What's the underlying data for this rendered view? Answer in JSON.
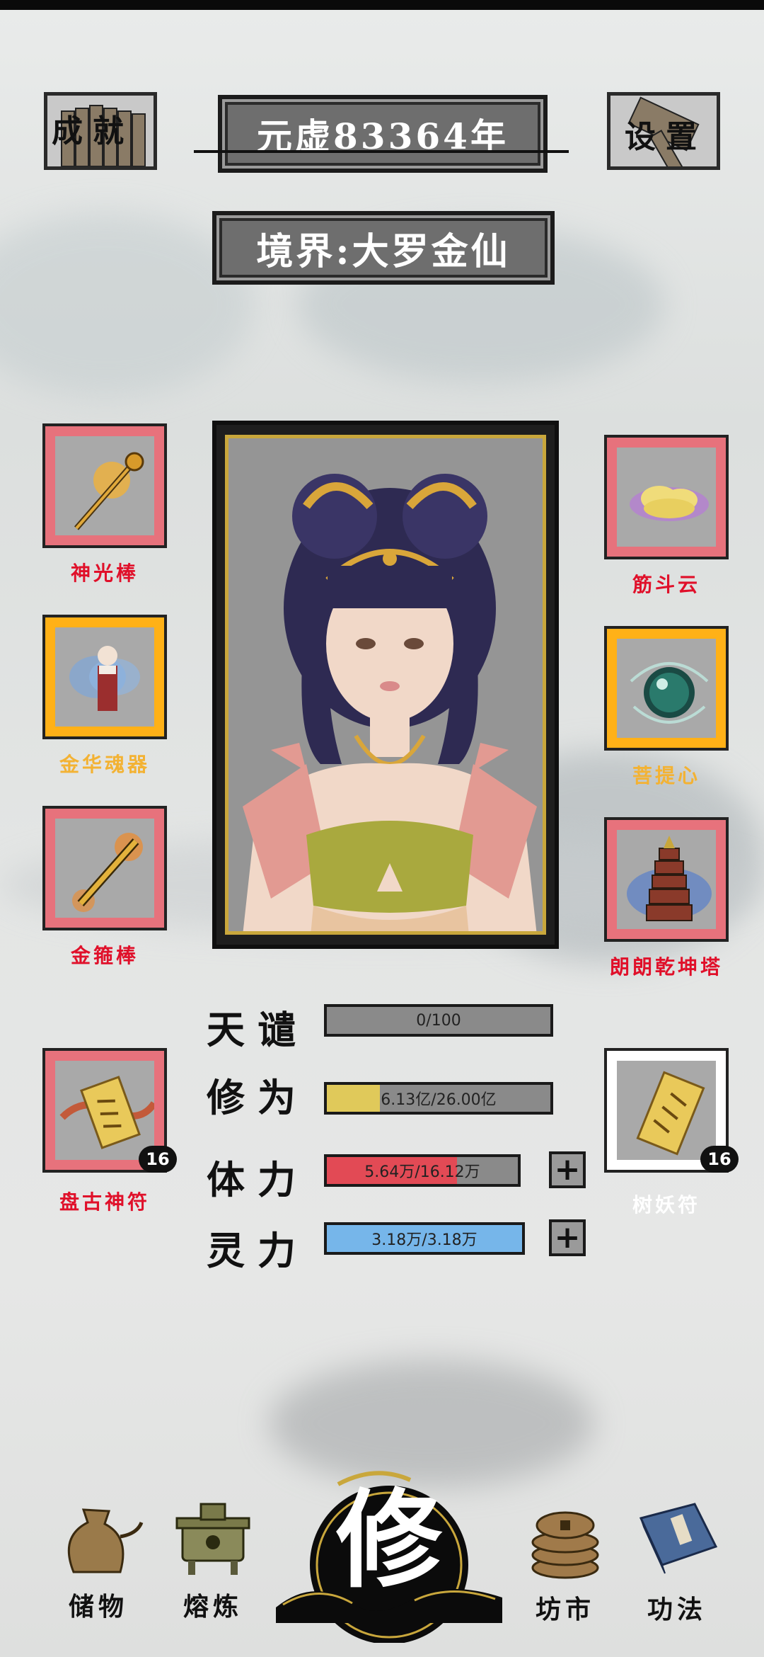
{
  "header": {
    "achievements_label": "成就",
    "year": "元虚83364年",
    "settings_label": "设置",
    "realm": "境界:大罗金仙"
  },
  "slots": {
    "left": [
      {
        "name": "神光棒",
        "frame": "red",
        "label_color": "#e0102a",
        "icon": "golden-staff-icon"
      },
      {
        "name": "金华魂器",
        "frame": "gold",
        "label_color": "#f3b233",
        "icon": "spirit-figure-icon"
      },
      {
        "name": "金箍棒",
        "frame": "red",
        "label_color": "#e0102a",
        "icon": "golden-rod-icon"
      },
      {
        "name": "盘古神符",
        "frame": "red",
        "label_color": "#e0102a",
        "icon": "talisman-icon",
        "count": "16"
      }
    ],
    "right": [
      {
        "name": "筋斗云",
        "frame": "red",
        "label_color": "#e0102a",
        "icon": "cloud-icon"
      },
      {
        "name": "菩提心",
        "frame": "gold",
        "label_color": "#f3b233",
        "icon": "orb-icon"
      },
      {
        "name": "朗朗乾坤塔",
        "frame": "red",
        "label_color": "#e0102a",
        "icon": "pagoda-icon"
      },
      {
        "name": "树妖符",
        "frame": "white",
        "label_color": "#ffffff",
        "icon": "talisman-icon",
        "count": "16"
      }
    ]
  },
  "stats": {
    "tribulation": {
      "label": "天谴",
      "text": "0/100",
      "progress": 0.0,
      "color": "#8a8a8a"
    },
    "cultivation": {
      "label": "修为",
      "text": "6.13亿/26.00亿",
      "progress": 0.236,
      "color": "#e0c95a"
    },
    "stamina": {
      "label": "体力",
      "text": "5.64万/16.12万",
      "progress": 0.68,
      "color": "#e24a55"
    },
    "spirit": {
      "label": "灵力",
      "text": "3.18万/3.18万",
      "progress": 1.0,
      "color": "#76b6ea"
    }
  },
  "nav": {
    "storage": "储物",
    "smelting": "熔炼",
    "cultivate": "修",
    "market": "坊市",
    "techniques": "功法"
  }
}
